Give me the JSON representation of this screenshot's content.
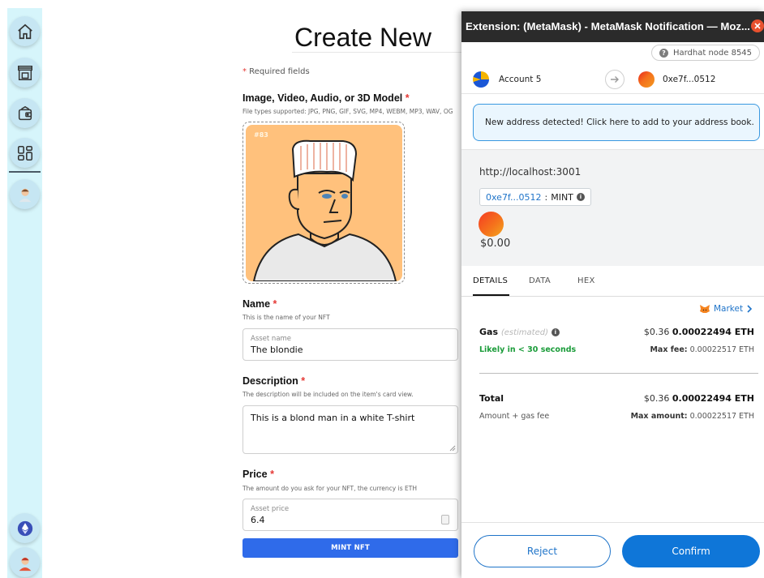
{
  "sidebar": {
    "items": [
      {
        "icon": "home-icon"
      },
      {
        "icon": "storefront-icon"
      },
      {
        "icon": "wallet-icon"
      },
      {
        "icon": "dashboard-grid-icon"
      },
      {
        "icon": "profile-avatar-icon"
      }
    ],
    "bottom": [
      {
        "icon": "ethereum-icon"
      },
      {
        "icon": "user-avatar-icon"
      }
    ]
  },
  "form": {
    "title": "Create New",
    "required_star": "*",
    "required_note": " Required fields",
    "media_label": "Image, Video, Audio, or 3D Model",
    "media_sub": "File types supported: JPG, PNG, GIF, SVG, MP4, WEBM, MP3, WAV, OG",
    "nft_tag": "#83",
    "name_label": "Name",
    "name_sub": "This is the name of your NFT",
    "name_placeholder": "Asset name",
    "name_value": "The blondie",
    "description_label": "Description",
    "description_sub": "The description will be included on the item's card view.",
    "description_value": "This is a blond man in a white T-shirt",
    "price_label": "Price",
    "price_sub": "The amount do you ask for your NFT, the currency is ETH",
    "price_placeholder": "Asset price",
    "price_value": "6.4",
    "mint_button": "MINT NFT"
  },
  "metamask": {
    "window_title": "Extension: (MetaMask) - MetaMask Notification — Moz...",
    "network": "Hardhat node 8545",
    "network_icon_glyph": "?",
    "from_account": "Account 5",
    "to_account": "0xe7f...0512",
    "banner": "New address detected! Click here to add to your address book.",
    "origin_url": "http://localhost:3001",
    "method_address": "0xe7f...0512",
    "method_sep": " : ",
    "method_name": "MINT",
    "info_glyph": "i",
    "amount": "$0.00",
    "tabs": [
      "DETAILS",
      "DATA",
      "HEX"
    ],
    "market_label": "Market",
    "gas_label": "Gas",
    "gas_estimated": "(estimated)",
    "gas_fiat": "$0.36",
    "gas_eth": "0.00022494 ETH",
    "gas_likely": "Likely in < 30 seconds",
    "max_fee_label": "Max fee:",
    "max_fee_value": "0.00022517 ETH",
    "total_label": "Total",
    "total_fiat": "$0.36",
    "total_eth": "0.00022494 ETH",
    "total_sub": "Amount + gas fee",
    "max_amount_label": "Max amount:",
    "max_amount_value": "0.00022517 ETH",
    "reject_button": "Reject",
    "confirm_button": "Confirm",
    "accent_color": "#0f76d8"
  }
}
